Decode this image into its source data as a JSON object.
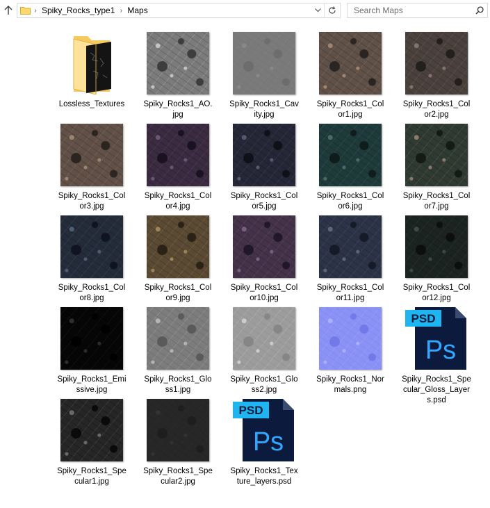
{
  "breadcrumb": {
    "path": [
      "Spiky_Rocks_type1",
      "Maps"
    ],
    "separator": "›"
  },
  "search": {
    "placeholder": "Search Maps"
  },
  "icons": {
    "up": "up-arrow-icon",
    "folder": "folder-icon",
    "dropdown": "chevron-down-icon",
    "refresh": "refresh-icon",
    "search": "search-icon",
    "psd": "photoshop-psd-icon"
  },
  "psd_icon": {
    "badge": "PSD",
    "logo": "Ps",
    "badge_color": "#1fb5f0",
    "body_color": "#0c1a3d",
    "logo_color": "#31a8ff"
  },
  "items": [
    {
      "name": "Lossless_Textures",
      "kind": "folder"
    },
    {
      "name": "Spiky_Rocks1_AO.jpg",
      "kind": "image",
      "tex": "ao"
    },
    {
      "name": "Spiky_Rocks1_Cavity.jpg",
      "kind": "image",
      "tex": "cavity"
    },
    {
      "name": "Spiky_Rocks1_Color1.jpg",
      "kind": "image",
      "tex": "c1"
    },
    {
      "name": "Spiky_Rocks1_Color2.jpg",
      "kind": "image",
      "tex": "c2"
    },
    {
      "name": "Spiky_Rocks1_Color3.jpg",
      "kind": "image",
      "tex": "c3"
    },
    {
      "name": "Spiky_Rocks1_Color4.jpg",
      "kind": "image",
      "tex": "c4"
    },
    {
      "name": "Spiky_Rocks1_Color5.jpg",
      "kind": "image",
      "tex": "c5"
    },
    {
      "name": "Spiky_Rocks1_Color6.jpg",
      "kind": "image",
      "tex": "c6"
    },
    {
      "name": "Spiky_Rocks1_Color7.jpg",
      "kind": "image",
      "tex": "c7"
    },
    {
      "name": "Spiky_Rocks1_Color8.jpg",
      "kind": "image",
      "tex": "c8"
    },
    {
      "name": "Spiky_Rocks1_Color9.jpg",
      "kind": "image",
      "tex": "c9"
    },
    {
      "name": "Spiky_Rocks1_Color10.jpg",
      "kind": "image",
      "tex": "c10"
    },
    {
      "name": "Spiky_Rocks1_Color11.jpg",
      "kind": "image",
      "tex": "c11"
    },
    {
      "name": "Spiky_Rocks1_Color12.jpg",
      "kind": "image",
      "tex": "c12"
    },
    {
      "name": "Spiky_Rocks1_Emissive.jpg",
      "kind": "image",
      "tex": "emissive"
    },
    {
      "name": "Spiky_Rocks1_Gloss1.jpg",
      "kind": "image",
      "tex": "gloss1"
    },
    {
      "name": "Spiky_Rocks1_Gloss2.jpg",
      "kind": "image",
      "tex": "gloss2"
    },
    {
      "name": "Spiky_Rocks1_Normals.png",
      "kind": "image",
      "tex": "normals"
    },
    {
      "name": "Spiky_Rocks1_Specular_Gloss_Layers.psd",
      "kind": "psd"
    },
    {
      "name": "Spiky_Rocks1_Specular1.jpg",
      "kind": "image",
      "tex": "spec1"
    },
    {
      "name": "Spiky_Rocks1_Specular2.jpg",
      "kind": "image",
      "tex": "spec2"
    },
    {
      "name": "Spiky_Rocks1_Texture_layers.psd",
      "kind": "psd"
    }
  ]
}
